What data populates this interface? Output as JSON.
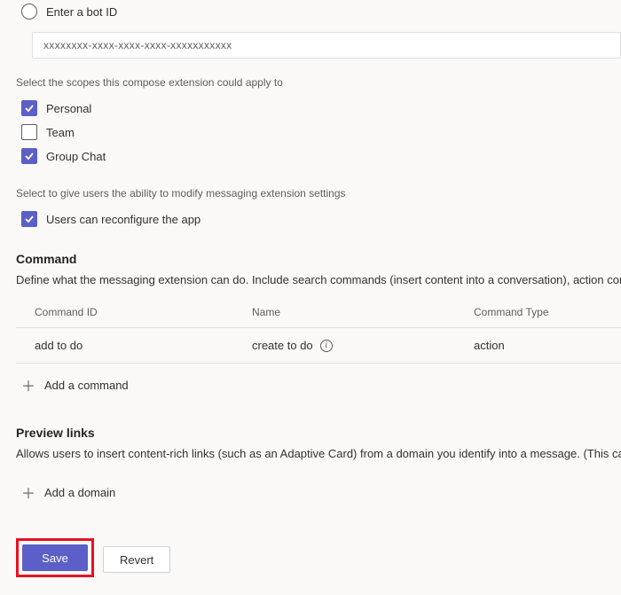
{
  "bot": {
    "radio_label": "Enter a bot ID",
    "input_value": "xxxxxxxx-xxxx-xxxx-xxxx-xxxxxxxxxxx"
  },
  "scopes": {
    "label": "Select the scopes this compose extension could apply to",
    "items": [
      {
        "label": "Personal",
        "checked": true
      },
      {
        "label": "Team",
        "checked": false
      },
      {
        "label": "Group Chat",
        "checked": true
      }
    ]
  },
  "settings": {
    "label": "Select to give users the ability to modify messaging extension settings",
    "reconfigure_label": "Users can reconfigure the app",
    "reconfigure_checked": true
  },
  "command": {
    "title": "Command",
    "desc": "Define what the messaging extension can do. Include search commands (insert content into a conversation), action commands (a",
    "headers": {
      "id": "Command ID",
      "name": "Name",
      "type": "Command Type"
    },
    "rows": [
      {
        "id": "add to do",
        "name": "create to do",
        "type": "action"
      }
    ],
    "add_label": "Add a command"
  },
  "preview": {
    "title": "Preview links",
    "desc": "Allows users to insert content-rich links (such as an Adaptive Card) from a domain you identify into a message. (This capability is ",
    "add_label": "Add a domain"
  },
  "buttons": {
    "save": "Save",
    "revert": "Revert"
  }
}
